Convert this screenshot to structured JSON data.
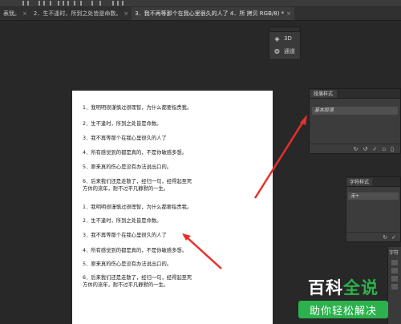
{
  "tabs": [
    {
      "label": "表我。",
      "active": false
    },
    {
      "label": "2．生不逢时，所到之处皆是命数。",
      "active": false
    },
    {
      "label": "3．我不再等那个在我心里很久的人了 4．所 拷贝 RGB/8) *",
      "active": true
    }
  ],
  "mini_panel": {
    "items": [
      {
        "label": "3D",
        "icon": "cube-icon"
      },
      {
        "label": "通道",
        "icon": "channels-icon"
      }
    ]
  },
  "paragraph_styles": {
    "title": "段落样式",
    "item": "基本段落",
    "footer_icons": [
      "refresh-icon",
      "redo-icon",
      "check-icon",
      "new-icon",
      "trash-icon"
    ]
  },
  "character_styles": {
    "title": "字符样式",
    "item": "无+",
    "footer_icons": [
      "refresh-icon",
      "check-icon"
    ]
  },
  "edge_panel": {
    "label": "字符"
  },
  "document": {
    "block1": [
      "1．我明明很谨慎过很理智，为什么都要指责我。",
      "2．生不逢时，所到之处皆是命数。",
      "3．我不再等那个在我心里很久的人了",
      "4．所有感觉到的都是真的，不是你敏感多想。",
      "5．原来真的伤心是没有办法说出口的。",
      "6．后来我们还是走散了，经归一句，经得起至死",
      "方休的流年，耐不过平凡静默的一生。"
    ],
    "block2": [
      "1．我明明很谨慎过很理智，为什么都要指责我。",
      "2．生不逢时，所到之处皆是命数。",
      "3．我不再等那个在我心里很久的人了",
      "4．所有感觉到的都是真的，不是你敏感多想。",
      "5．原来真的伤心是没有办法说出口的。",
      "6．后来我们还是走散了，经归一句，经得起至死",
      "方休的流年，耐不过平凡静默的一生。"
    ]
  },
  "watermark": {
    "line1_a": "百科",
    "line1_b": "全说",
    "line2": "助你轻松解决"
  },
  "colors": {
    "arrow": "#e8302b",
    "watermark_green": "#2bb24c",
    "workspace": "#282828"
  }
}
